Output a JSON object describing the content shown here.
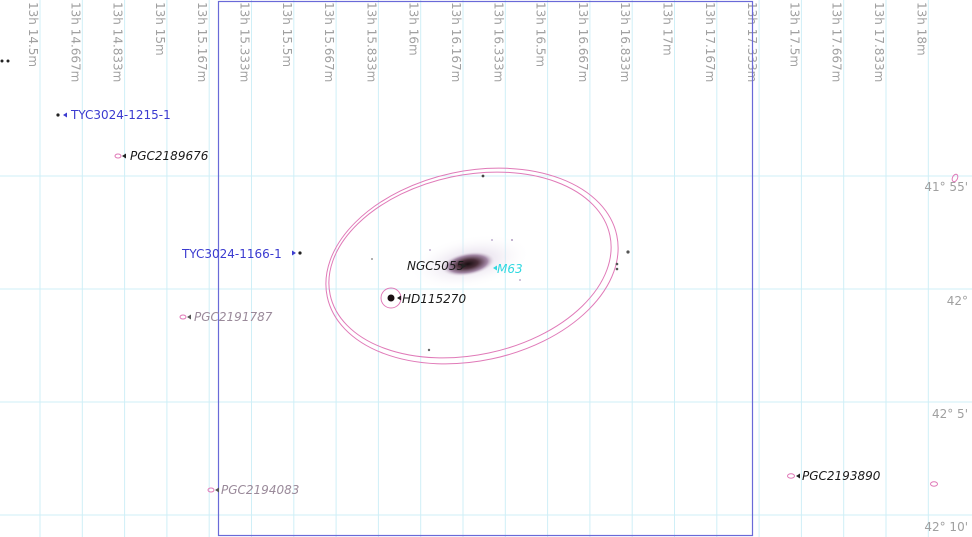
{
  "colors": {
    "grid": "#cfeff7",
    "field": "#6a6ad8",
    "galaxy_outline": "#e07ab8",
    "star_label": "#3b3bd0",
    "pgc_label_dark": "#1a1a1a",
    "pgc_label_light": "#9a8a9a",
    "m63_label": "#30d8e0",
    "axis_label": "#a0a0a0"
  },
  "ra_labels": [
    "13h 14.5m",
    "13h 14.667m",
    "13h 14.833m",
    "13h 15m",
    "13h 15.167m",
    "13h 15.333m",
    "13h 15.5m",
    "13h 15.667m",
    "13h 15.833m",
    "13h 16m",
    "13h 16.167m",
    "13h 16.333m",
    "13h 16.5m",
    "13h 16.667m",
    "13h 16.833m",
    "13h 17m",
    "13h 17.167m",
    "13h 17.333m",
    "13h 17.5m",
    "13h 17.667m",
    "13h 17.833m",
    "13h 18m"
  ],
  "dec_labels": [
    "41° 55'",
    "42°",
    "42° 5'",
    "42° 10'"
  ],
  "objects": {
    "tyc1215": "TYC3024-1215-1",
    "pgc2189676": "PGC2189676",
    "tyc1166": "TYC3024-1166-1",
    "ngc5055": "NGC5055",
    "m63": "M63",
    "hd115270": "HD115270",
    "pgc2191787": "PGC2191787",
    "pgc2194083": "PGC2194083",
    "pgc2193890": "PGC2193890"
  }
}
